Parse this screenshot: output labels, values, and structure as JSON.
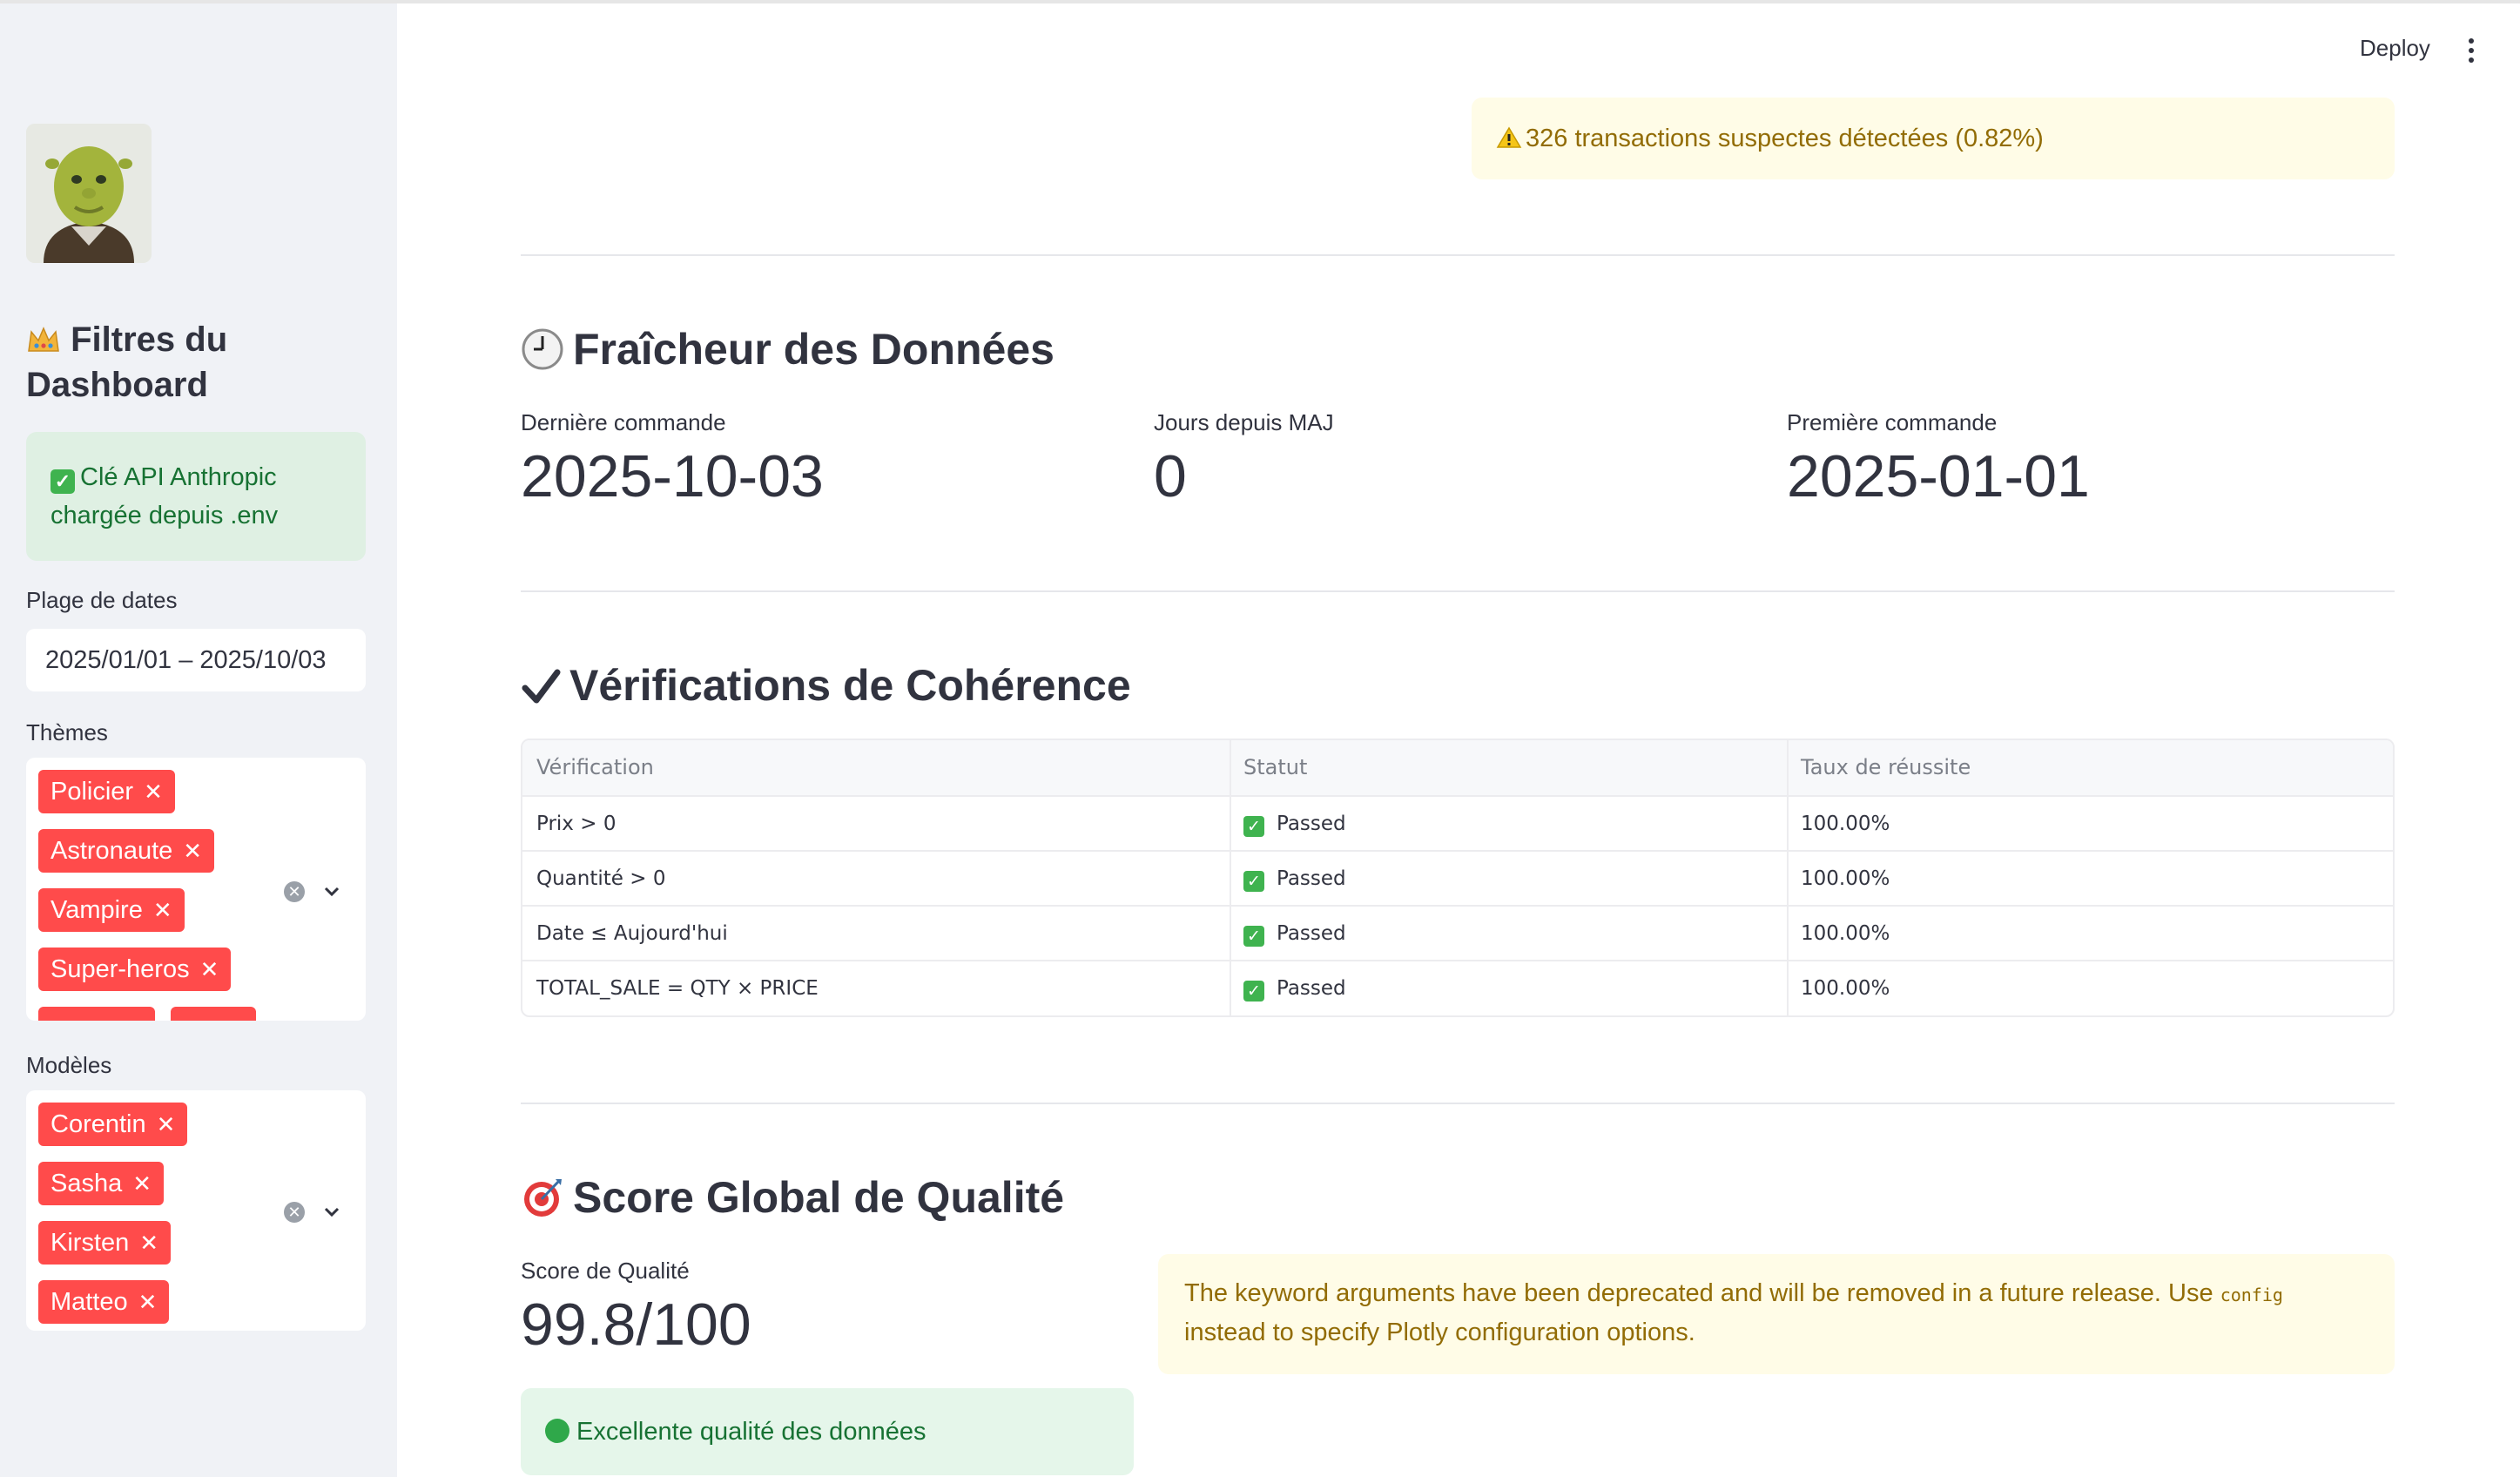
{
  "sidebar": {
    "title": "Filtres du Dashboard",
    "api_message": "Clé API Anthropic chargée depuis .env",
    "date_range": {
      "label": "Plage de dates",
      "value": "2025/01/01 – 2025/10/03"
    },
    "themes": {
      "label": "Thèmes",
      "tags": [
        "Policier",
        "Astronaute",
        "Vampire",
        "Super-heros"
      ]
    },
    "models": {
      "label": "Modèles",
      "tags": [
        "Corentin",
        "Sasha",
        "Kirsten",
        "Matteo"
      ]
    },
    "icons": {
      "title_icon": "crown-icon",
      "api_icon": "check-box-icon",
      "remove_icon": "close-icon",
      "clear_icon": "clear-circle-icon",
      "dropdown_icon": "chevron-down-icon"
    }
  },
  "header": {
    "deploy_label": "Deploy",
    "menu_icon": "kebab-menu-icon"
  },
  "alert": {
    "text": "326 transactions suspectes détectées (0.82%)",
    "icon": "warning-icon"
  },
  "freshness": {
    "title": "Fraîcheur des Données",
    "icon": "clock-icon",
    "metrics": [
      {
        "label": "Dernière commande",
        "value": "2025-10-03"
      },
      {
        "label": "Jours depuis MAJ",
        "value": "0"
      },
      {
        "label": "Première commande",
        "value": "2025-01-01"
      }
    ]
  },
  "checks": {
    "title": "Vérifications de Cohérence",
    "icon": "checkmark-icon",
    "columns": [
      "Vérification",
      "Statut",
      "Taux de réussite"
    ],
    "rows": [
      {
        "check": "Prix > 0",
        "status": "Passed",
        "rate": "100.00%"
      },
      {
        "check": "Quantité > 0",
        "status": "Passed",
        "rate": "100.00%"
      },
      {
        "check": "Date ≤ Aujourd'hui",
        "status": "Passed",
        "rate": "100.00%"
      },
      {
        "check": "TOTAL_SALE = QTY × PRICE",
        "status": "Passed",
        "rate": "100.00%"
      }
    ]
  },
  "quality": {
    "title": "Score Global de Qualité",
    "icon": "target-icon",
    "score_label": "Score de Qualité",
    "score_value": "99.8/100",
    "deprecation_part1": "The keyword arguments have been deprecated and will be removed in a future release. Use ",
    "deprecation_code": "config",
    "deprecation_part2": " instead to specify Plotly configuration options.",
    "success_text": "Excellente qualité des données",
    "colors": {
      "accent_red": "#ff4b4b",
      "success_green": "#177233",
      "warning_text": "#926c05",
      "warning_bg": "#fffce7",
      "success_bg": "#e5f6ea"
    }
  }
}
